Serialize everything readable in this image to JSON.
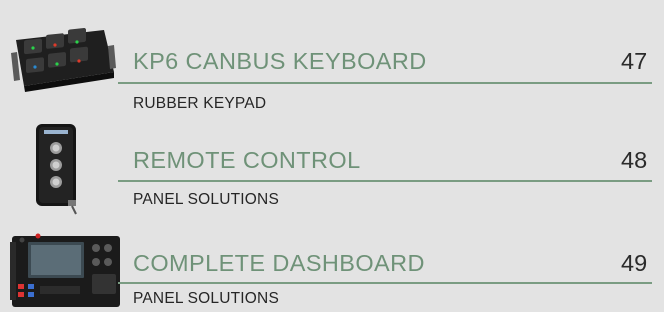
{
  "entries": [
    {
      "title": "KP6 CANBUS KEYBOARD",
      "page": "47",
      "subtitle": "RUBBER KEYPAD"
    },
    {
      "title": "REMOTE CONTROL",
      "page": "48",
      "subtitle": "PANEL SOLUTIONS"
    },
    {
      "title": "COMPLETE DASHBOARD",
      "page": "49",
      "subtitle": "PANEL SOLUTIONS"
    }
  ]
}
